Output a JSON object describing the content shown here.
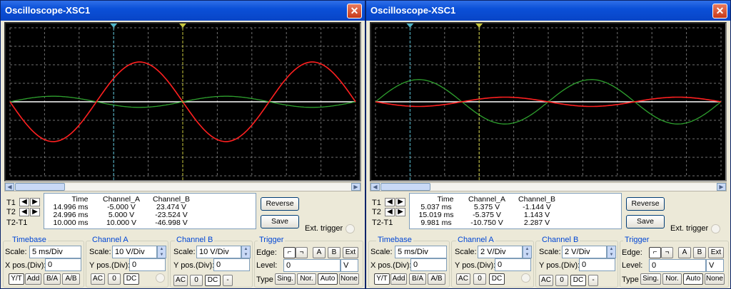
{
  "colors": {
    "trace_a": "#ff2020",
    "trace_b": "#2ea02e",
    "cursor1": "#4fb4c8",
    "cursor2": "#c8c83c",
    "grid": "#707070",
    "screen": "#000000"
  },
  "windows": [
    {
      "title": "Oscilloscope-XSC1",
      "close_icon": "x-icon",
      "trace_a_amplitude_div": 2.15,
      "trace_b_amplitude_div": 0.3,
      "cursor_labels": {
        "t1": "T1",
        "t2": "T2",
        "t2t1": "T2-T1"
      },
      "readout": {
        "headers": [
          "Time",
          "Channel_A",
          "Channel_B"
        ],
        "rows": [
          [
            "14.996 ms",
            "-5.000 V",
            "23.474 V"
          ],
          [
            "24.996 ms",
            "5.000 V",
            "-23.524 V"
          ],
          [
            "10.000 ms",
            "10.000 V",
            "-46.998 V"
          ]
        ]
      },
      "buttons": {
        "reverse": "Reverse",
        "save": "Save",
        "ext_trigger": "Ext. trigger"
      },
      "timebase": {
        "title": "Timebase",
        "scale_label": "Scale:",
        "scale": "5 ms/Div",
        "xpos_label": "X pos.(Div):",
        "xpos": "0",
        "modes": [
          "Y/T",
          "Add",
          "B/A",
          "A/B"
        ]
      },
      "channel_a": {
        "title": "Channel A",
        "scale_label": "Scale:",
        "scale": "10  V/Div",
        "ypos_label": "Y pos.(Div):",
        "ypos": "0",
        "coupling": [
          "AC",
          "0",
          "DC"
        ]
      },
      "channel_b": {
        "title": "Channel B",
        "scale_label": "Scale:",
        "scale": "10  V/Div",
        "ypos_label": "Y pos.(Div):",
        "ypos": "0",
        "coupling": [
          "AC",
          "0",
          "DC",
          "-"
        ]
      },
      "trigger": {
        "title": "Trigger",
        "edge_label": "Edge:",
        "edges": [
          "A",
          "B",
          "Ext"
        ],
        "level_label": "Level:",
        "level": "0",
        "level_unit": "V",
        "type_label": "Type",
        "types": [
          "Sing.",
          "Nor.",
          "Auto",
          "None"
        ]
      }
    },
    {
      "title": "Oscilloscope-XSC1",
      "close_icon": "x-icon",
      "trace_a_amplitude_div": 0.25,
      "trace_b_amplitude_div": 1.2,
      "cursor_labels": {
        "t1": "T1",
        "t2": "T2",
        "t2t1": "T2-T1"
      },
      "readout": {
        "headers": [
          "Time",
          "Channel_A",
          "Channel_B"
        ],
        "rows": [
          [
            "5.037 ms",
            "5.375 V",
            "-1.144 V"
          ],
          [
            "15.019 ms",
            "-5.375 V",
            "1.143 V"
          ],
          [
            "9.981 ms",
            "-10.750 V",
            "2.287 V"
          ]
        ]
      },
      "buttons": {
        "reverse": "Reverse",
        "save": "Save",
        "ext_trigger": "Ext. trigger"
      },
      "timebase": {
        "title": "Timebase",
        "scale_label": "Scale:",
        "scale": "5 ms/Div",
        "xpos_label": "X pos.(Div):",
        "xpos": "0",
        "modes": [
          "Y/T",
          "Add",
          "B/A",
          "A/B"
        ]
      },
      "channel_a": {
        "title": "Channel A",
        "scale_label": "Scale:",
        "scale": "2  V/Div",
        "ypos_label": "Y pos.(Div):",
        "ypos": "0",
        "coupling": [
          "AC",
          "0",
          "DC"
        ]
      },
      "channel_b": {
        "title": "Channel B",
        "scale_label": "Scale:",
        "scale": "2  V/Div",
        "ypos_label": "Y pos.(Div):",
        "ypos": "0",
        "coupling": [
          "AC",
          "0",
          "DC",
          "-"
        ]
      },
      "trigger": {
        "title": "Trigger",
        "edge_label": "Edge:",
        "edges": [
          "A",
          "B",
          "Ext"
        ],
        "level_label": "Level:",
        "level": "0",
        "level_unit": "V",
        "type_label": "Type",
        "types": [
          "Sing.",
          "Nor.",
          "Auto",
          "None"
        ]
      }
    }
  ]
}
